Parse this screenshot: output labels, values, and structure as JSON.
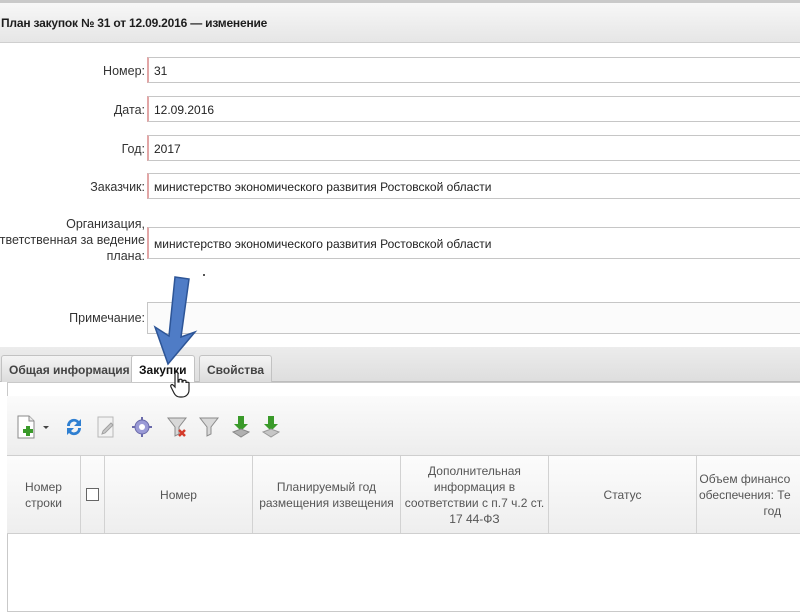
{
  "window": {
    "title": "План закупок № 31 от 12.09.2016 — изменение"
  },
  "form": {
    "number": {
      "label": "Номер:",
      "value": "31"
    },
    "date": {
      "label": "Дата:",
      "value": "12.09.2016"
    },
    "year": {
      "label": "Год:",
      "value": "2017"
    },
    "customer": {
      "label": "Заказчик:",
      "value": "министерство экономического развития Ростовской области"
    },
    "organization": {
      "label_lines": [
        "Организация,",
        "ответственная за ведение",
        "плана:"
      ],
      "value": "министерство экономического развития Ростовской области"
    },
    "note": {
      "label": "Примечание:",
      "value": ""
    }
  },
  "tabs": [
    {
      "label": "Общая информация",
      "active": false
    },
    {
      "label": "Закупки",
      "active": true
    },
    {
      "label": "Свойства",
      "active": false
    }
  ],
  "toolbar": {
    "icons": [
      "add-document-icon",
      "dropdown-arrow-icon",
      "refresh-icon",
      "edit-icon",
      "settings-icon",
      "clear-filter-icon",
      "filter-icon",
      "export-down-icon",
      "export-down-alt-icon"
    ]
  },
  "grid": {
    "columns": [
      {
        "lines": [
          "Номер",
          "строки"
        ]
      },
      {
        "lines": []
      },
      {
        "lines": [
          "Номер"
        ]
      },
      {
        "lines": [
          "Планируемый год",
          "размещения извещения"
        ]
      },
      {
        "lines": [
          "Дополнительная",
          "информация в",
          "соответствии с п.7 ч.2 ст.",
          "17 44-ФЗ"
        ]
      },
      {
        "lines": [
          "Статус"
        ]
      },
      {
        "lines": [
          "Объем финансо",
          "обеспечения: Те",
          "год"
        ]
      }
    ]
  },
  "colors": {
    "required_border": "#e2a6a6",
    "arrow_fill": "#4f7cc6",
    "icon_green": "#3a9a2a",
    "icon_blue": "#2f7fd1",
    "icon_red": "#d43a2a"
  }
}
